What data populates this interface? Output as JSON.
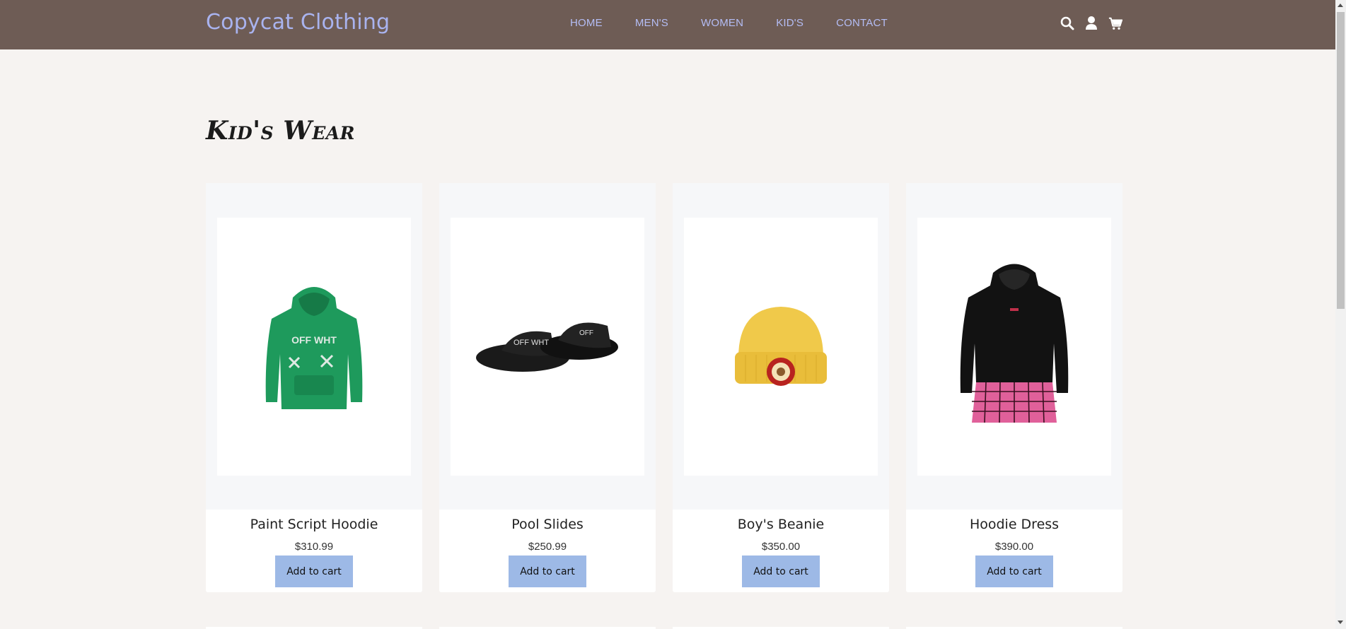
{
  "header": {
    "brand": "Copycat Clothing",
    "nav": [
      "HOME",
      "MEN'S",
      "WOMEN",
      "KID'S",
      "CONTACT"
    ],
    "icons": [
      "search-icon",
      "user-icon",
      "cart-icon"
    ]
  },
  "page": {
    "title": "Kid's Wear"
  },
  "products": [
    {
      "name": "Paint Script Hoodie",
      "price": "$310.99",
      "button": "Add to cart",
      "image": "green-hoodie"
    },
    {
      "name": "Pool Slides",
      "price": "$250.99",
      "button": "Add to cart",
      "image": "black-slides"
    },
    {
      "name": "Boy's Beanie",
      "price": "$350.00",
      "button": "Add to cart",
      "image": "yellow-beanie"
    },
    {
      "name": "Hoodie Dress",
      "price": "$390.00",
      "button": "Add to cart",
      "image": "black-hoodie-dress"
    }
  ],
  "colors": {
    "header_bg": "#6e5c55",
    "brand": "#a9b3ef",
    "nav_link": "#b4bdf5",
    "button_bg": "#9db9e6",
    "page_bg": "#f6f3f1"
  }
}
